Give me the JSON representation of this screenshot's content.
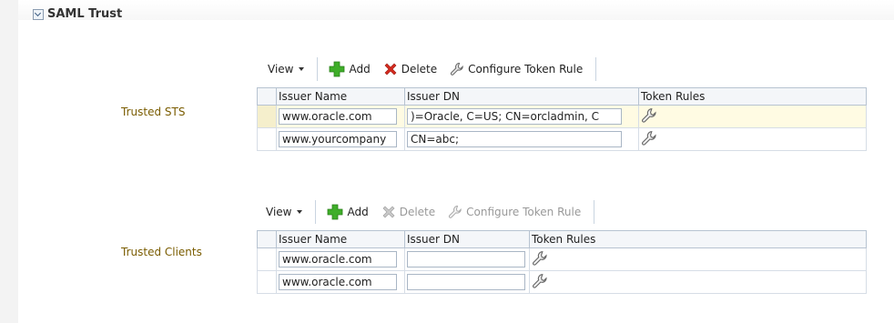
{
  "section": {
    "title": "SAML Trust"
  },
  "toolbar_labels": {
    "view": "View",
    "add": "Add",
    "delete": "Delete",
    "configure": "Configure Token Rule"
  },
  "trusted_sts": {
    "label": "Trusted STS",
    "columns": [
      "Issuer Name",
      "Issuer DN",
      "Token Rules"
    ],
    "rows": [
      {
        "issuer_name": "www.oracle.com",
        "issuer_dn": ")=Oracle, C=US; CN=orcladmin, C",
        "selected": true
      },
      {
        "issuer_name": "www.yourcompany",
        "issuer_dn": "CN=abc;",
        "selected": false
      }
    ]
  },
  "trusted_clients": {
    "label": "Trusted Clients",
    "columns": [
      "Issuer Name",
      "Issuer DN",
      "Token Rules"
    ],
    "rows": [
      {
        "issuer_name": "www.oracle.com",
        "issuer_dn": ""
      },
      {
        "issuer_name": "www.oracle.com",
        "issuer_dn": ""
      }
    ]
  },
  "icons": {
    "add": "plus-icon",
    "delete": "x-delete-icon",
    "configure": "wrench-icon",
    "token_rule": "wrench-icon",
    "disclose": "chevron-down-icon"
  },
  "colors": {
    "label_text": "#7a5c00",
    "add_green": "#3fae29",
    "delete_red": "#d42a1e",
    "selected_row": "#fffbe3"
  }
}
